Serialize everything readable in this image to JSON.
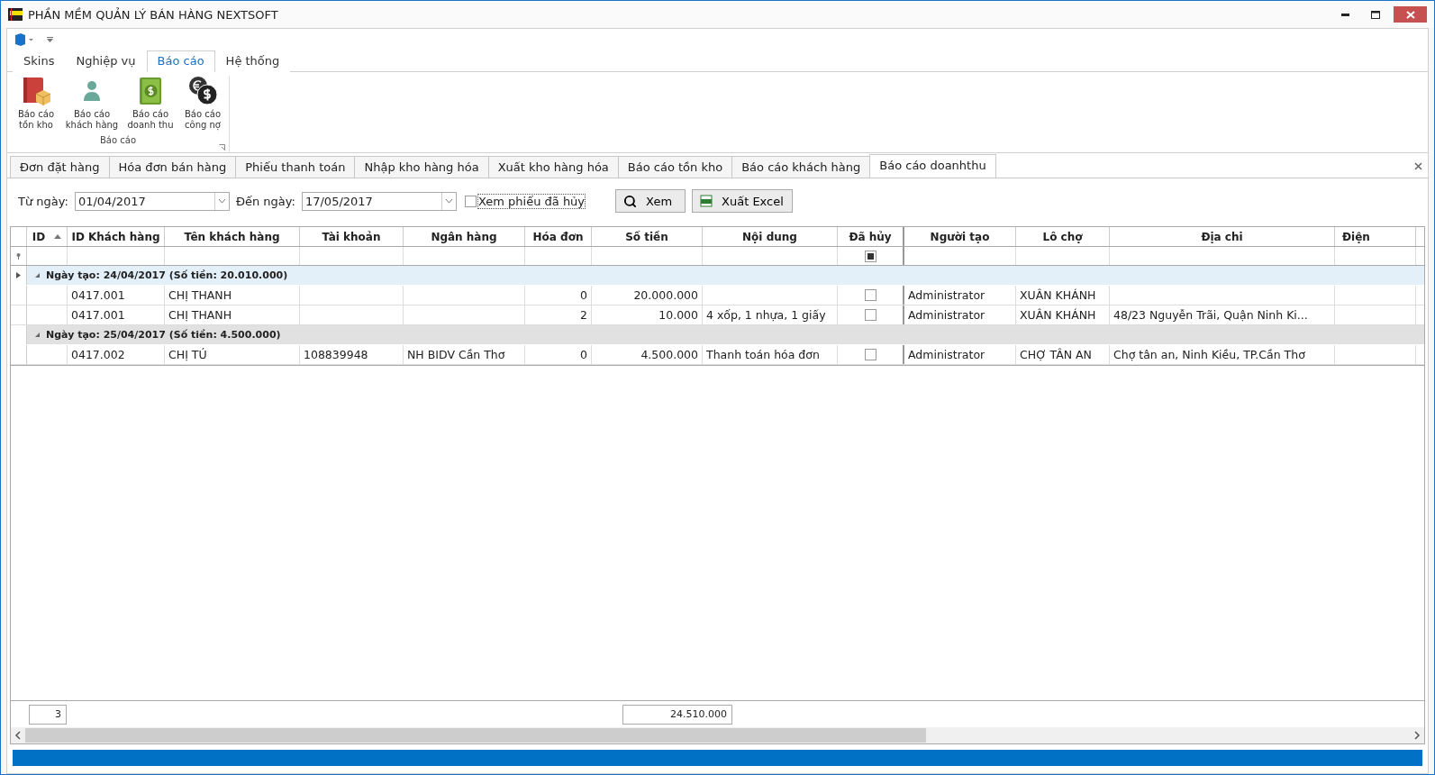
{
  "window": {
    "title": "PHẦN MỀM QUẢN LÝ BÁN HÀNG NEXTSOFT"
  },
  "ribbon_tabs": [
    {
      "label": "Skins",
      "selected": false
    },
    {
      "label": "Nghiệp vụ",
      "selected": false
    },
    {
      "label": "Báo cáo",
      "selected": true
    },
    {
      "label": "Hệ thống",
      "selected": false
    }
  ],
  "ribbon_group": {
    "title": "Báo cáo",
    "buttons": [
      {
        "kind": "stock",
        "label": "Báo cáo tồn kho"
      },
      {
        "kind": "customer",
        "label": "Báo cáo khách hàng"
      },
      {
        "kind": "revenue",
        "label": "Báo cáo doanh thu"
      },
      {
        "kind": "debt",
        "label": "Báo cáo công nợ"
      }
    ]
  },
  "doc_tabs": [
    {
      "label": "Đơn đặt hàng",
      "selected": false
    },
    {
      "label": "Hóa đơn bán hàng",
      "selected": false
    },
    {
      "label": "Phiếu thanh toán",
      "selected": false
    },
    {
      "label": "Nhập kho hàng hóa",
      "selected": false
    },
    {
      "label": "Xuất kho hàng hóa",
      "selected": false
    },
    {
      "label": "Báo cáo tồn kho",
      "selected": false
    },
    {
      "label": "Báo cáo khách hàng",
      "selected": false
    },
    {
      "label": "Báo cáo doanhthu",
      "selected": true
    }
  ],
  "filter": {
    "from_label": "Từ ngày:",
    "from_value": "01/04/2017",
    "to_label": "Đến ngày:",
    "to_value": "17/05/2017",
    "cancelled_label": "Xem phiếu đã hủy",
    "cancelled_checked": false,
    "view_button": "Xem",
    "excel_button": "Xuất Excel"
  },
  "table": {
    "columns": [
      {
        "label": "ID",
        "sorted": true
      },
      {
        "label": "ID Khách hàng",
        "sorted": false
      },
      {
        "label": "Tên khách hàng",
        "sorted": false
      },
      {
        "label": "Tài khoản",
        "sorted": false
      },
      {
        "label": "Ngân hàng",
        "sorted": false
      },
      {
        "label": "Hóa đơn",
        "sorted": false
      },
      {
        "label": "Số tiền",
        "sorted": false
      },
      {
        "label": "Nội dung",
        "sorted": false
      },
      {
        "label": "Đã hủy",
        "sorted": false
      },
      {
        "label": "Người tạo",
        "sorted": false
      },
      {
        "label": "Lô chợ",
        "sorted": false
      },
      {
        "label": "Địa chi",
        "sorted": false
      },
      {
        "label": "Điện",
        "sorted": false
      }
    ],
    "cancelled_filter_mixed": true,
    "groups": [
      {
        "label": "Ngày tạo: 24/04/2017 (Số tiền: 20.010.000)",
        "expanded": true,
        "selected": true,
        "rows": [
          {
            "customer_id": "0417.001",
            "customer_name": "CHỊ THANH",
            "invoice": "0",
            "amount": "20.000.000",
            "cancelled": false,
            "creator": "Administrator",
            "market": "XUÂN KHÁNH"
          },
          {
            "customer_id": "0417.001",
            "customer_name": "CHỊ THANH",
            "invoice": "2",
            "amount": "10.000",
            "content": "4 xốp, 1 nhựa, 1 giấy",
            "cancelled": false,
            "creator": "Administrator",
            "market": "XUÂN KHÁNH",
            "address": "48/23 Nguyễn Trãi, Quận Ninh Ki..."
          }
        ]
      },
      {
        "label": "Ngày tạo: 25/04/2017 (Số tiền: 4.500.000)",
        "expanded": true,
        "selected": false,
        "rows": [
          {
            "customer_id": "0417.002",
            "customer_name": "CHỊ TÚ",
            "account": "108839948",
            "bank": "NH BIDV Cần Thơ",
            "invoice": "0",
            "amount": "4.500.000",
            "content": "Thanh toán hóa đơn",
            "cancelled": false,
            "creator": "Administrator",
            "market": "CHỢ TÂN AN",
            "address": "Chợ tân an, Ninh Kiều, TP.Cần Thơ"
          }
        ]
      }
    ],
    "footer": {
      "count": "3",
      "total": "24.510.000"
    }
  }
}
